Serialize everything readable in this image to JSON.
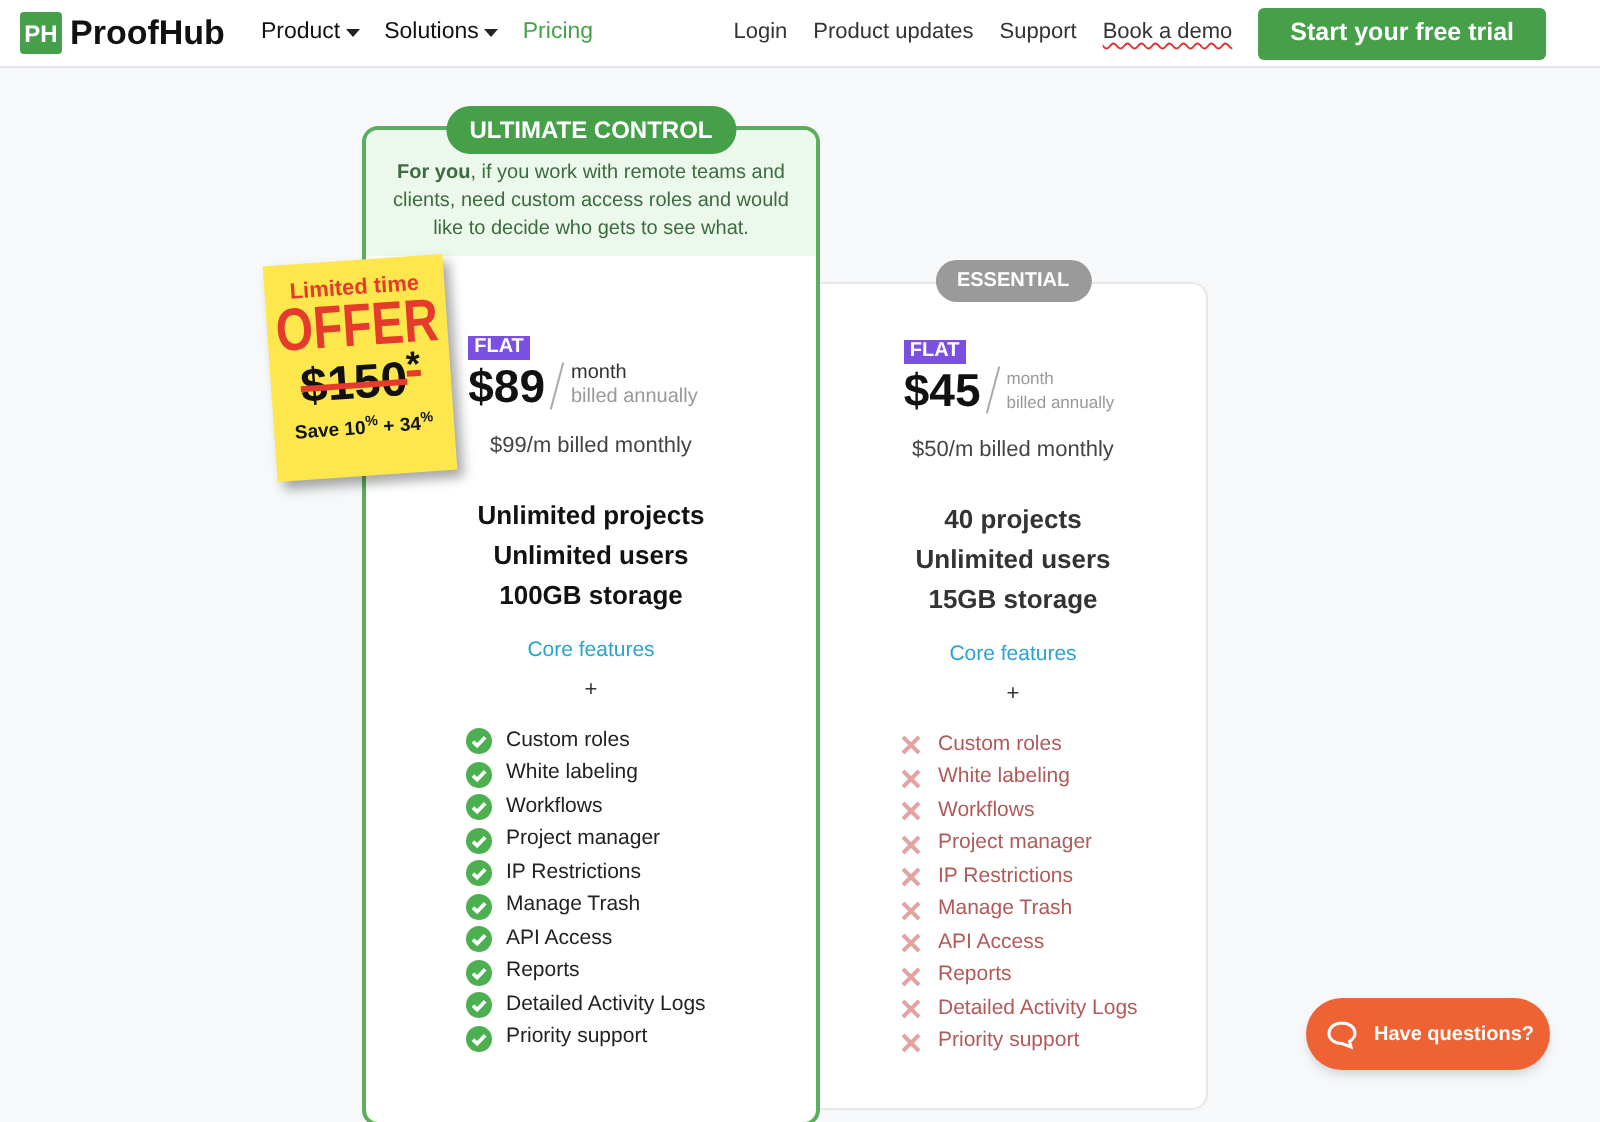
{
  "header": {
    "logo_mark": "PH",
    "logo_text": "ProofHub",
    "nav": [
      {
        "label": "Product",
        "dropdown": true,
        "selected": false
      },
      {
        "label": "Solutions",
        "dropdown": true,
        "selected": false
      },
      {
        "label": "Pricing",
        "dropdown": false,
        "selected": true
      }
    ],
    "links": [
      "Login",
      "Product updates",
      "Support",
      "Book a demo"
    ],
    "cta": "Start your free trial"
  },
  "offer": {
    "line1": "Limited time",
    "line2": "OFFER",
    "old_price": "$150$^{*}$",
    "save": "Save 10$^{%}$ + 34$^{%}$"
  },
  "plans": [
    {
      "kind": "highlighted",
      "badge": "ULTIMATE CONTROL",
      "description": "**For you**, if you work with remote teams and clients, need custom access roles and would like to decide who gets to see what.",
      "tag": "FLAT",
      "price": "$89",
      "period": "month",
      "billing": "billed annually",
      "monthly": "$99/m billed monthly",
      "quotas": [
        "Unlimited projects",
        "Unlimited users",
        "100GB storage"
      ],
      "features_link": "Core features",
      "plus": "+",
      "features": [
        {
          "label": "Custom roles",
          "included": true
        },
        {
          "label": "White labeling",
          "included": true
        },
        {
          "label": "Workflows",
          "included": true
        },
        {
          "label": "Project manager",
          "included": true
        },
        {
          "label": "IP Restrictions",
          "included": true
        },
        {
          "label": "Manage Trash",
          "included": true
        },
        {
          "label": "API Access",
          "included": true
        },
        {
          "label": "Reports",
          "included": true
        },
        {
          "label": "Detailed Activity Logs",
          "included": true
        },
        {
          "label": "Priority support",
          "included": true
        }
      ]
    },
    {
      "kind": "plain",
      "badge": "ESSENTIAL",
      "tag": "FLAT",
      "price": "$45",
      "period": "month",
      "billing": "billed annually",
      "monthly": "$50/m billed monthly",
      "quotas": [
        "40 projects",
        "Unlimited users",
        "15GB storage"
      ],
      "features_link": "Core features",
      "plus": "+",
      "features": [
        {
          "label": "Custom roles",
          "included": false
        },
        {
          "label": "White labeling",
          "included": false
        },
        {
          "label": "Workflows",
          "included": false
        },
        {
          "label": "Project manager",
          "included": false
        },
        {
          "label": "IP Restrictions",
          "included": false
        },
        {
          "label": "Manage Trash",
          "included": false
        },
        {
          "label": "API Access",
          "included": false
        },
        {
          "label": "Reports",
          "included": false
        },
        {
          "label": "Detailed Activity Logs",
          "included": false
        },
        {
          "label": "Priority support",
          "included": false
        }
      ]
    }
  ],
  "chat_button": "Have questions?"
}
